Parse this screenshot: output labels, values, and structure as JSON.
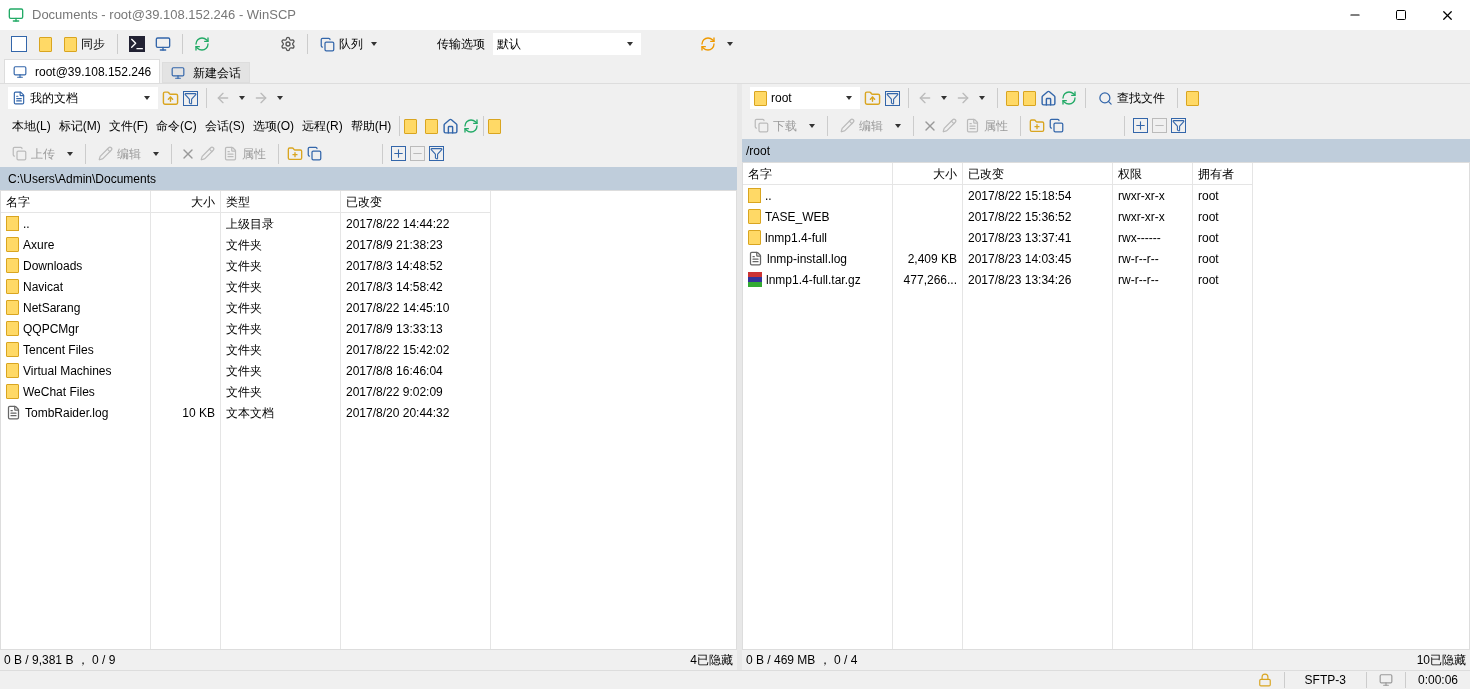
{
  "window": {
    "title": "Documents - root@39.108.152.246 - WinSCP"
  },
  "toolbar": {
    "sync_label": "同步",
    "queue_label": "队列",
    "transfer_label": "传输选项",
    "transfer_value": "默认"
  },
  "session_tabs": [
    {
      "label": "root@39.108.152.246",
      "selected": true
    },
    {
      "label": "新建会话",
      "selected": false
    }
  ],
  "local_pane": {
    "location": "我的文档",
    "menu": [
      "本地(L)",
      "标记(M)",
      "文件(F)",
      "命令(C)",
      "会话(S)",
      "选项(O)",
      "远程(R)",
      "帮助(H)"
    ],
    "actions": [
      {
        "kind": "upload",
        "label": "上传",
        "disabled": true
      },
      {
        "kind": "edit",
        "label": "编辑",
        "disabled": true
      },
      {
        "kind": "properties",
        "label": "属性",
        "disabled": true
      }
    ],
    "path": "C:\\Users\\Admin\\Documents",
    "columns": [
      "名字",
      "大小",
      "类型",
      "已改变"
    ],
    "rows": [
      {
        "kind": "parent",
        "name": "..",
        "size": "",
        "type": "上级目录",
        "modified": "2017/8/22  14:44:22"
      },
      {
        "kind": "folder",
        "name": "Axure",
        "size": "",
        "type": "文件夹",
        "modified": "2017/8/9  21:38:23"
      },
      {
        "kind": "folder",
        "name": "Downloads",
        "size": "",
        "type": "文件夹",
        "modified": "2017/8/3  14:48:52"
      },
      {
        "kind": "folder",
        "name": "Navicat",
        "size": "",
        "type": "文件夹",
        "modified": "2017/8/3  14:58:42"
      },
      {
        "kind": "folder",
        "name": "NetSarang",
        "size": "",
        "type": "文件夹",
        "modified": "2017/8/22  14:45:10"
      },
      {
        "kind": "folder",
        "name": "QQPCMgr",
        "size": "",
        "type": "文件夹",
        "modified": "2017/8/9  13:33:13"
      },
      {
        "kind": "folder",
        "name": "Tencent Files",
        "size": "",
        "type": "文件夹",
        "modified": "2017/8/22  15:42:02"
      },
      {
        "kind": "folder",
        "name": "Virtual Machines",
        "size": "",
        "type": "文件夹",
        "modified": "2017/8/8  16:46:04"
      },
      {
        "kind": "folder",
        "name": "WeChat Files",
        "size": "",
        "type": "文件夹",
        "modified": "2017/8/22  9:02:09"
      },
      {
        "kind": "file",
        "name": "TombRaider.log",
        "size": "10 KB",
        "type": "文本文档",
        "modified": "2017/8/20  20:44:32"
      }
    ],
    "status": "0 B / 9,381 B ， 0 / 9",
    "hidden": "4已隐藏"
  },
  "remote_pane": {
    "location": "root",
    "find_label": "查找文件",
    "actions": [
      {
        "kind": "download",
        "label": "下载",
        "disabled": true
      },
      {
        "kind": "edit",
        "label": "编辑",
        "disabled": true
      },
      {
        "kind": "properties",
        "label": "属性",
        "disabled": true
      }
    ],
    "path": "/root",
    "columns": [
      "名字",
      "大小",
      "已改变",
      "权限",
      "拥有者"
    ],
    "rows": [
      {
        "kind": "parent",
        "name": "..",
        "size": "",
        "modified": "2017/8/22 15:18:54",
        "rights": "rwxr-xr-x",
        "owner": "root"
      },
      {
        "kind": "folder",
        "name": "TASE_WEB",
        "size": "",
        "modified": "2017/8/22 15:36:52",
        "rights": "rwxr-xr-x",
        "owner": "root"
      },
      {
        "kind": "folder",
        "name": "lnmp1.4-full",
        "size": "",
        "modified": "2017/8/23 13:37:41",
        "rights": "rwx------",
        "owner": "root"
      },
      {
        "kind": "file",
        "name": "lnmp-install.log",
        "size": "2,409 KB",
        "modified": "2017/8/23 14:03:45",
        "rights": "rw-r--r--",
        "owner": "root"
      },
      {
        "kind": "archive",
        "name": "lnmp1.4-full.tar.gz",
        "size": "477,266...",
        "modified": "2017/8/23 13:34:26",
        "rights": "rw-r--r--",
        "owner": "root"
      }
    ],
    "status": "0 B / 469 MB ， 0 / 4",
    "hidden": "10已隐藏"
  },
  "status_bar": {
    "protocol": "SFTP-3",
    "elapsed": "0:00:06"
  }
}
